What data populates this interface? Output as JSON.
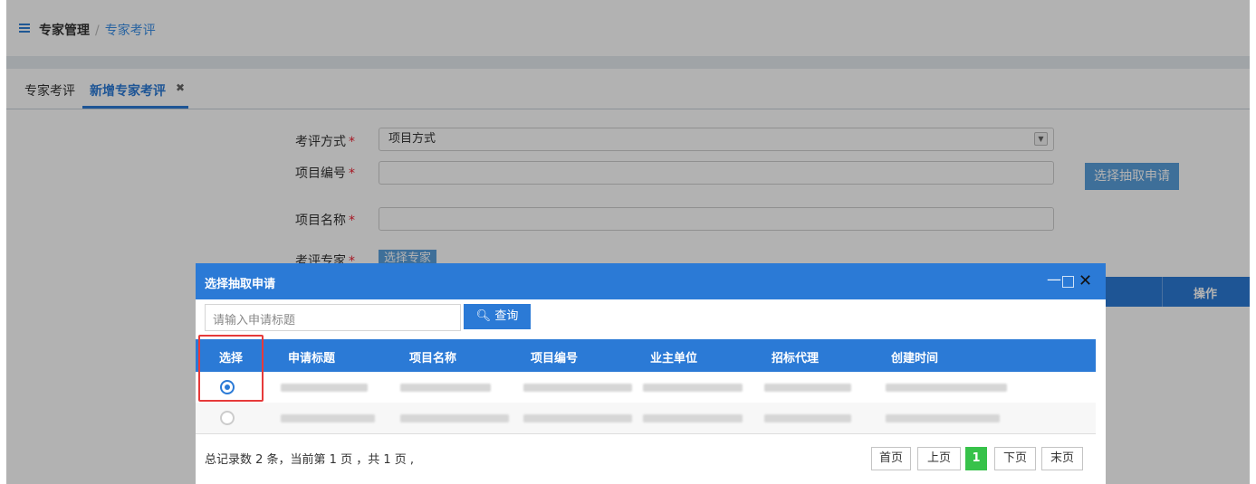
{
  "breadcrumb": {
    "root": "专家管理",
    "separator": "/",
    "current": "专家考评"
  },
  "tabs": [
    {
      "label": "专家考评"
    },
    {
      "label": "新增专家考评"
    }
  ],
  "form": {
    "method_label": "考评方式",
    "method_value": "项目方式",
    "project_no_label": "项目编号",
    "project_name_label": "项目名称",
    "expert_label": "考评专家",
    "required_mark": "*",
    "select_apply_button": "选择抽取申请",
    "select_expert_button": "选择专家",
    "ops_column": "操作"
  },
  "modal": {
    "title": "选择抽取申请",
    "minimize": "—",
    "close": "✕",
    "search_placeholder": "请输入申请标题",
    "query_button": "查询",
    "columns": [
      "选择",
      "申请标题",
      "项目名称",
      "项目编号",
      "业主单位",
      "招标代理",
      "创建时间"
    ],
    "rows": [
      {
        "selected": true
      },
      {
        "selected": false
      }
    ],
    "footer": "总记录数 2 条，当前第 1 页 ，共 1 页 ,",
    "pager": {
      "first": "首页",
      "prev": "上页",
      "current": "1",
      "next": "下页",
      "last": "末页"
    }
  },
  "colors": {
    "primary": "#2b7ad6",
    "pager_current": "#37c24a",
    "highlight": "#e63a3a"
  }
}
